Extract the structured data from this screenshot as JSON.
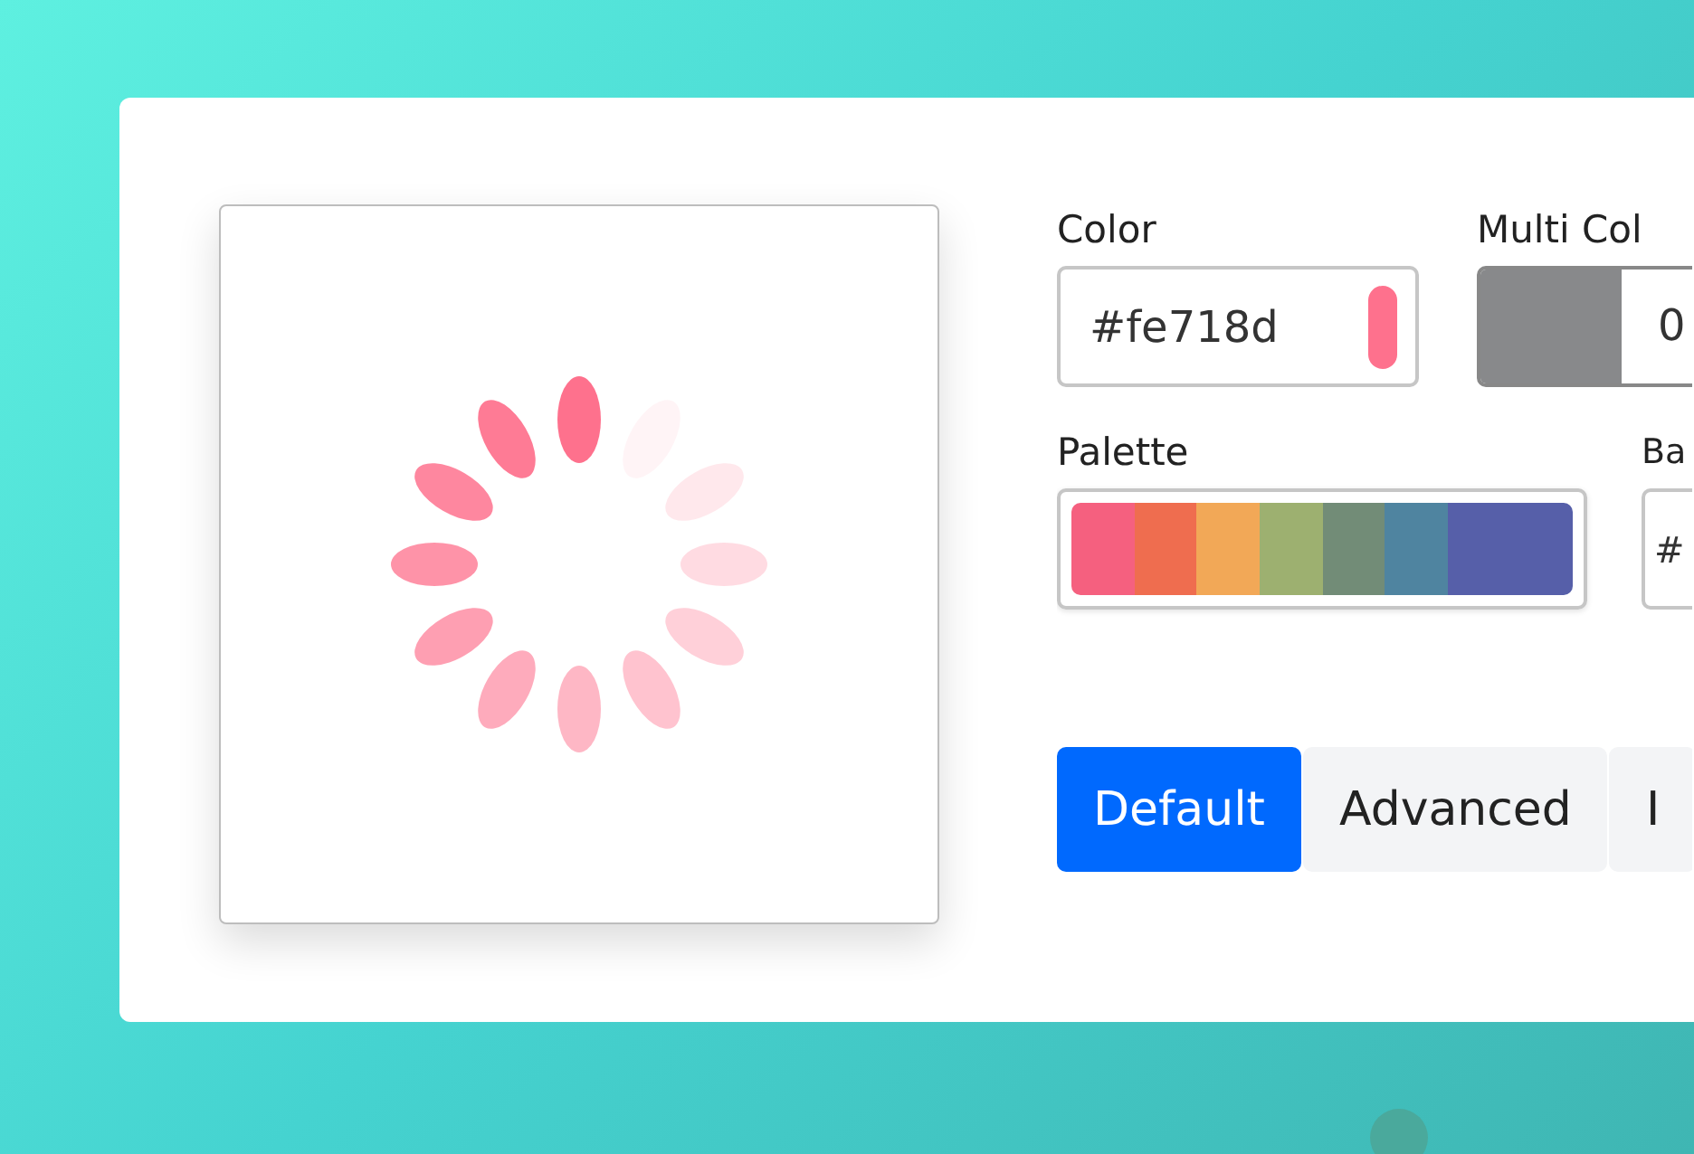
{
  "color_field": {
    "label": "Color",
    "value": "#fe718d"
  },
  "multi_color_field": {
    "label": "Multi Col",
    "value": "0"
  },
  "palette": {
    "label": "Palette",
    "colors": [
      {
        "color": "#f5607f"
      },
      {
        "color": "#ef6d4f"
      },
      {
        "color": "#f2a857"
      },
      {
        "color": "#9db070"
      },
      {
        "color": "#728c77"
      },
      {
        "color": "#4f84a0"
      },
      {
        "color": "#565fa9"
      }
    ]
  },
  "background_field": {
    "label": "Ba",
    "value": "#"
  },
  "tabs": [
    {
      "label": "Default",
      "selected": true
    },
    {
      "label": "Advanced",
      "selected": false
    },
    {
      "label": "I",
      "selected": false
    }
  ]
}
